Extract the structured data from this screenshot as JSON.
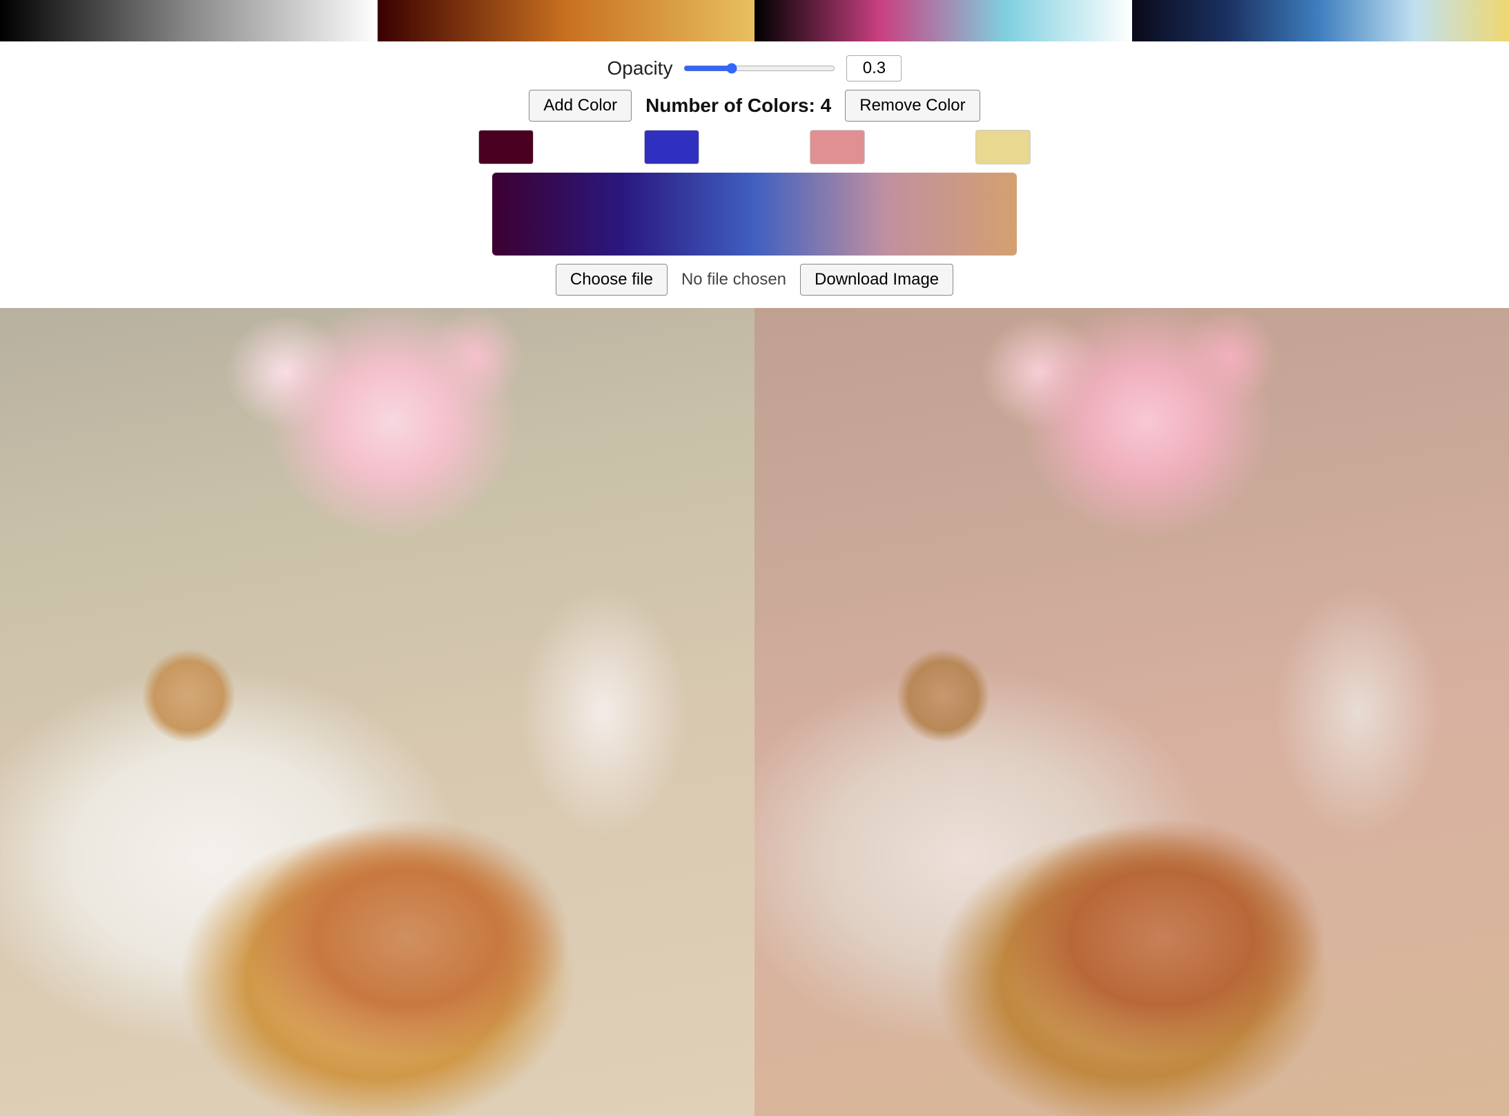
{
  "presetBars": [
    {
      "id": "bar1",
      "label": "Black to White gradient"
    },
    {
      "id": "bar2",
      "label": "Dark red to gold gradient"
    },
    {
      "id": "bar3",
      "label": "Black to pink to cyan gradient"
    },
    {
      "id": "bar4",
      "label": "Dark blue to yellow gradient"
    }
  ],
  "controls": {
    "opacity_label": "Opacity",
    "opacity_value": "0.3",
    "add_color_label": "Add Color",
    "num_colors_label": "Number of Colors: 4",
    "remove_color_label": "Remove Color"
  },
  "swatches": [
    {
      "color": "#4a0020",
      "label": "Dark red swatch"
    },
    {
      "color": "#3030c0",
      "label": "Blue swatch"
    },
    {
      "color": "#e09090",
      "label": "Pink swatch"
    },
    {
      "color": "#e8d890",
      "label": "Yellow swatch"
    }
  ],
  "gradient_preview": {
    "label": "Gradient preview bar",
    "css": "linear-gradient(to right, #3d0030, #2a1880, #c090a0, #d4a070)"
  },
  "file_section": {
    "choose_file_label": "Choose file",
    "no_file_text": "No file chosen",
    "download_label": "Download Image"
  },
  "images": {
    "original_label": "Original image",
    "filtered_label": "Filtered image"
  }
}
